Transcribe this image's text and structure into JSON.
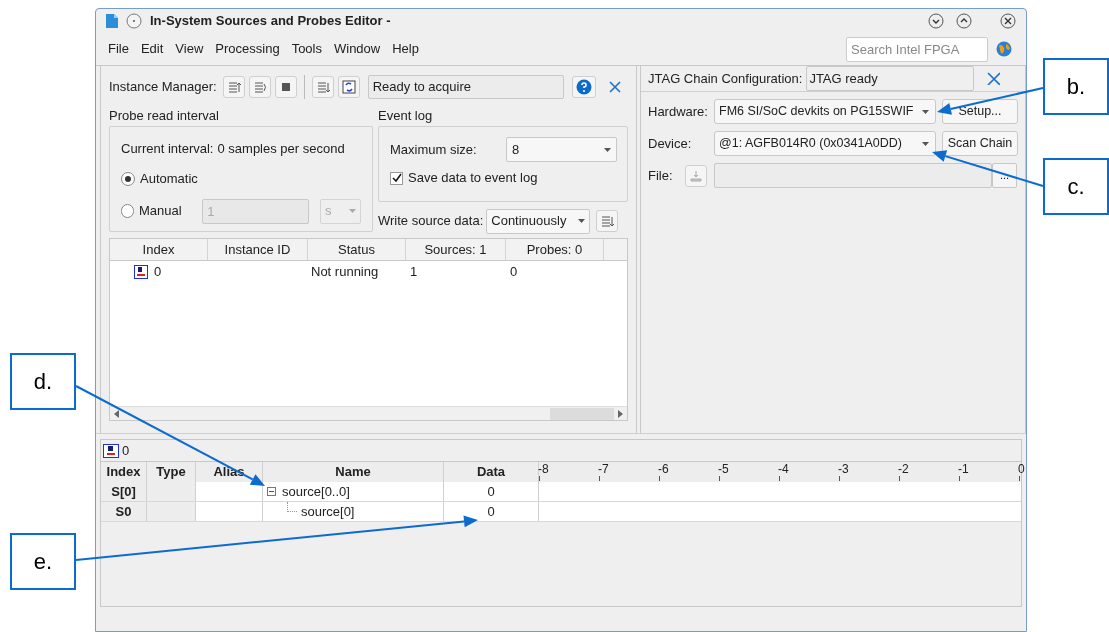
{
  "window": {
    "title": "In-System Sources and Probes Editor -"
  },
  "menu": [
    "File",
    "Edit",
    "View",
    "Processing",
    "Tools",
    "Window",
    "Help"
  ],
  "search": {
    "placeholder": "Search Intel FPGA"
  },
  "instance_manager": {
    "label": "Instance Manager:",
    "status": "Ready to acquire"
  },
  "probe_read_interval": {
    "title": "Probe read interval",
    "current_label": "Current interval:",
    "current_value": "0 samples per second",
    "modes": [
      {
        "label": "Automatic",
        "selected": true
      },
      {
        "label": "Manual",
        "selected": false
      }
    ],
    "manual_value": "1",
    "manual_unit": "s",
    "manual_disabled": true
  },
  "event_log": {
    "title": "Event log",
    "max_size_label": "Maximum size:",
    "max_size": "8",
    "save": {
      "label": "Save data to event log",
      "checked": true
    }
  },
  "write_source_data": {
    "label": "Write source data:",
    "value": "Continuously"
  },
  "instances": {
    "columns": [
      "Index",
      "Instance ID",
      "Status",
      "Sources: 1",
      "Probes: 0"
    ],
    "rows": [
      {
        "index": "0",
        "status": "Not running",
        "sources": "1",
        "probes": "0"
      }
    ]
  },
  "jtag": {
    "label": "JTAG Chain Configuration:",
    "status": "JTAG ready",
    "hardware_label": "Hardware:",
    "hardware": "FM6 SI/SoC devkits on PG15SWIF",
    "setup": "Setup...",
    "device_label": "Device:",
    "device": "@1: AGFB014R0 (0x0341A0DD)",
    "scan": "Scan Chain",
    "file_label": "File:",
    "browse": "..."
  },
  "data_view": {
    "tab": "0",
    "columns": [
      "Index",
      "Type",
      "Alias",
      "Name",
      "Data"
    ],
    "ruler": [
      "-8",
      "-7",
      "-6",
      "-5",
      "-4",
      "-3",
      "-2",
      "-1",
      "0"
    ],
    "rows": [
      {
        "index": "S[0]",
        "name": "source[0..0]",
        "data": "0",
        "expanded": true,
        "children": [
          {
            "index": "S0",
            "name": "source[0]",
            "data": "0"
          }
        ]
      }
    ]
  },
  "callouts": [
    "b.",
    "c.",
    "d.",
    "e."
  ]
}
